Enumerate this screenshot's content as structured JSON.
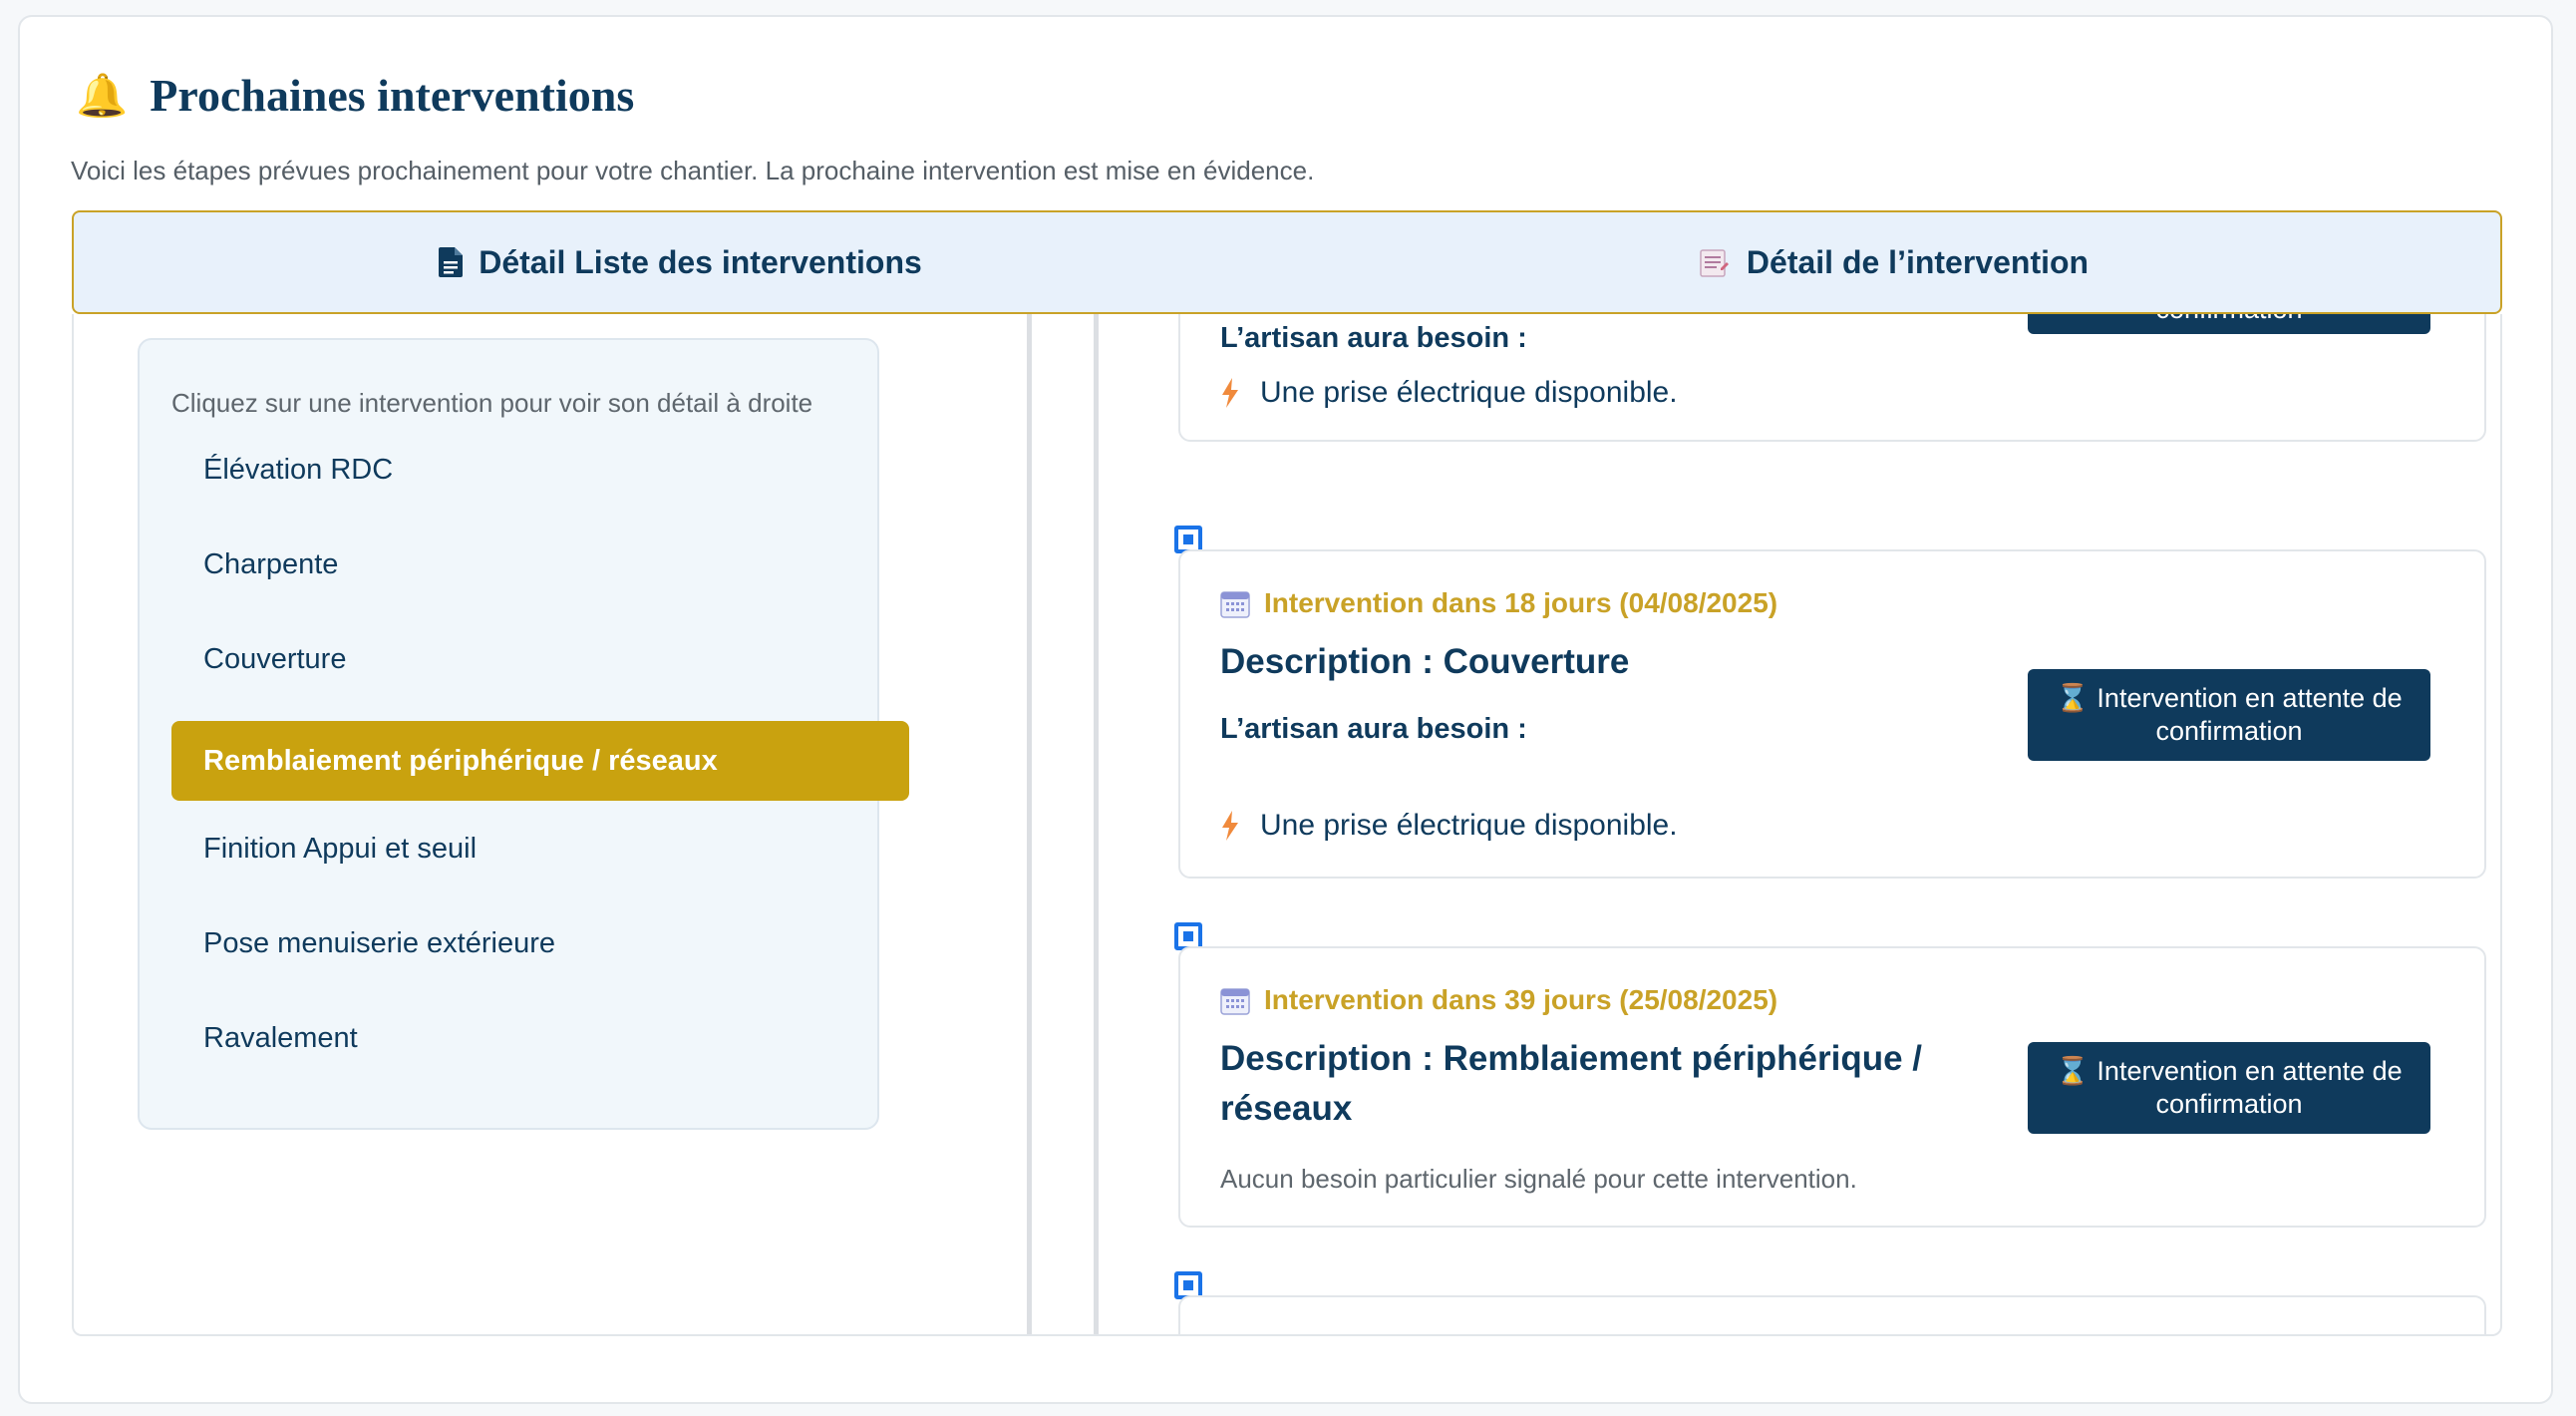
{
  "header": {
    "title": "Prochaines interventions",
    "subtitle": "Voici les étapes prévues prochainement pour votre chantier. La prochaine intervention est mise en évidence."
  },
  "tabs": [
    {
      "label": "Détail Liste des interventions",
      "icon": "document-icon"
    },
    {
      "label": "Détail de l’intervention",
      "icon": "notepad-icon"
    }
  ],
  "list": {
    "hint": "Cliquez sur une intervention pour voir son détail à droite",
    "items": [
      {
        "label": "Élévation RDC",
        "active": false
      },
      {
        "label": "Charpente",
        "active": false
      },
      {
        "label": "Couverture",
        "active": false
      },
      {
        "label": "Remblaiement périphérique / réseaux",
        "active": true
      },
      {
        "label": "Finition Appui et seuil",
        "active": false
      },
      {
        "label": "Pose menuiserie extérieure",
        "active": false
      },
      {
        "label": "Ravalement",
        "active": false
      }
    ]
  },
  "details": {
    "partial_top": {
      "needs_label": "L’artisan aura besoin :",
      "status": "confirmation",
      "need": "Une prise électrique disponible."
    },
    "cards": [
      {
        "date": "Intervention dans 18 jours (04/08/2025)",
        "description": "Description : Couverture",
        "needs_label": "L’artisan aura besoin :",
        "need": "Une prise électrique disponible.",
        "status": "⌛ Intervention en attente de confirmation"
      },
      {
        "date": "Intervention dans 39 jours (25/08/2025)",
        "description": "Description : Remblaiement périphérique / réseaux",
        "none": "Aucun besoin particulier signalé pour cette intervention.",
        "status": "⌛ Intervention en attente de confirmation"
      }
    ]
  },
  "colors": {
    "primary": "#0f3a5c",
    "accent": "#c9a227",
    "marker": "#1a73e8",
    "tab_bg": "#e8f1fb"
  }
}
